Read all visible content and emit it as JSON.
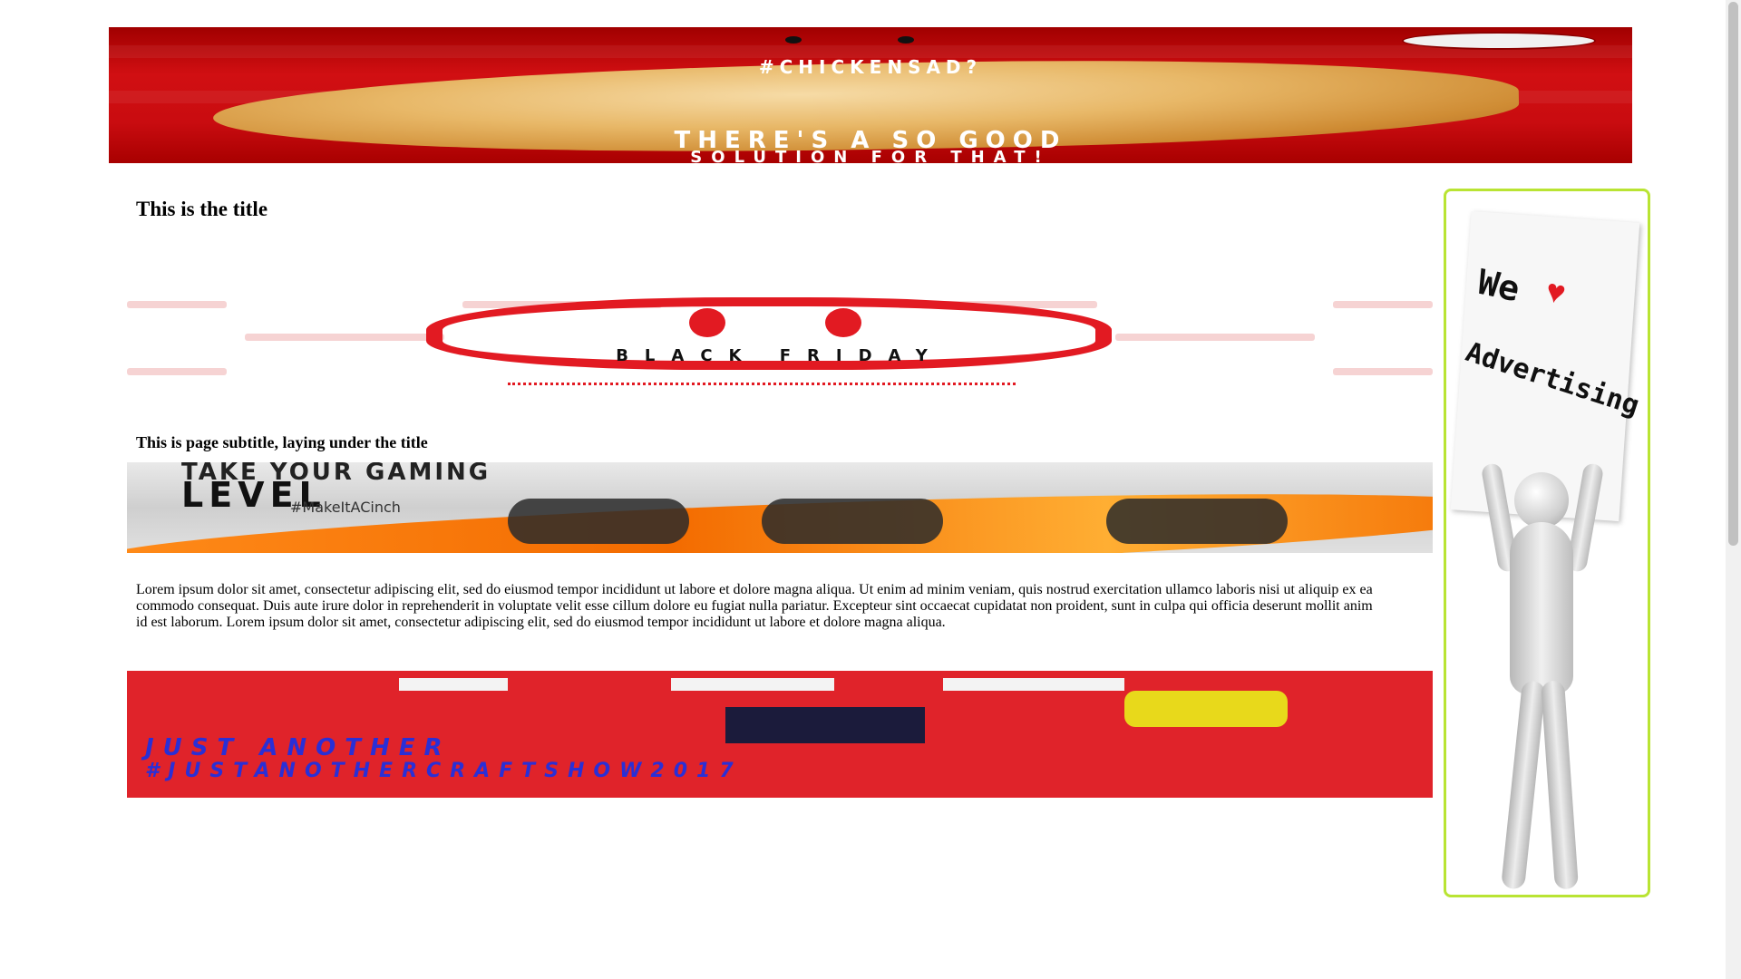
{
  "top_banner": {
    "hashtag": "#CHICKENSAD?",
    "line1": "THERE'S A SO GOOD",
    "line2": "SOLUTION FOR THAT!",
    "brand_color": "#c90c10"
  },
  "main": {
    "title": "This is the title",
    "subtitle": "This is page subtitle, laying under the title",
    "body": "Lorem ipsum dolor sit amet, consectetur adipiscing elit, sed do eiusmod tempor incididunt ut labore et dolore magna aliqua. Ut enim ad minim veniam, quis nostrud exercitation ullamco laboris nisi ut aliquip ex ea commodo consequat. Duis aute irure dolor in reprehenderit in voluptate velit esse cillum dolore eu fugiat nulla pariatur. Excepteur sint occaecat cupidatat non proident, sunt in culpa qui officia deserunt mollit anim id est laborum. Lorem ipsum dolor sit amet, consectetur adipiscing elit, sed do eiusmod tempor incididunt ut labore et dolore magna aliqua."
  },
  "sale_banner": {
    "sub": "BLACK FRIDAY",
    "accent_color": "#e21a22"
  },
  "gaming_banner": {
    "line1": "TAKE YOUR GAMING",
    "line2": "LEVEL",
    "hashtag": "#MakeItACinch",
    "accent_color": "#f36b00"
  },
  "event_banner": {
    "line1": "JUST ANOTHER",
    "line2": "#JUSTANOTHERCRAFTSHOW2017",
    "bg_color": "#e0232a"
  },
  "sidebar_ad": {
    "we": "We",
    "heart": "♥",
    "word": "Advertising",
    "border_color": "#b9e433"
  }
}
